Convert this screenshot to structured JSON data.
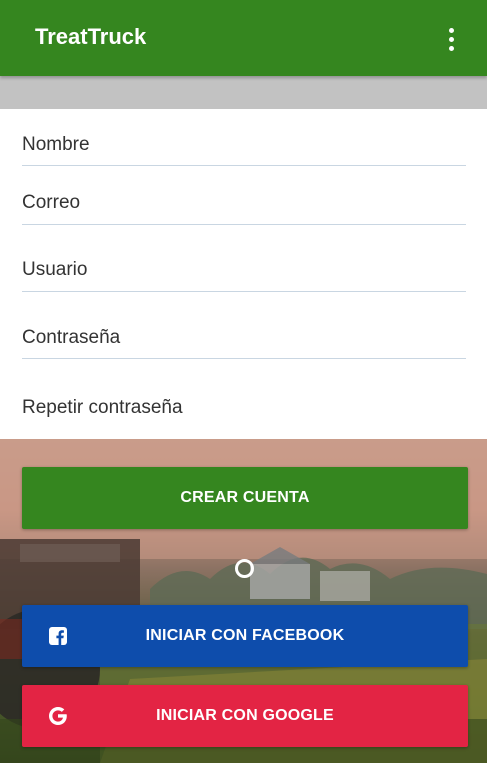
{
  "appbar": {
    "title": "TreatTruck",
    "menu_icon": "more-vert-icon"
  },
  "form": {
    "fields": [
      {
        "placeholder": "Nombre"
      },
      {
        "placeholder": "Correo"
      },
      {
        "placeholder": "Usuario"
      },
      {
        "placeholder": "Contraseña"
      },
      {
        "placeholder": "Repetir contraseña"
      }
    ]
  },
  "buttons": {
    "create": {
      "label": "CREAR CUENTA",
      "color": "#35861f"
    },
    "facebook": {
      "label": "INICIAR CON FACEBOOK",
      "color": "#0e4dac",
      "icon": "facebook-icon"
    },
    "google": {
      "label": "INICIAR CON GOOGLE",
      "color": "#e32444",
      "icon": "google-icon"
    }
  },
  "colors": {
    "primary": "#35861f",
    "strip": "#c2c2c2"
  },
  "loading": {
    "icon": "progress-spinner"
  }
}
